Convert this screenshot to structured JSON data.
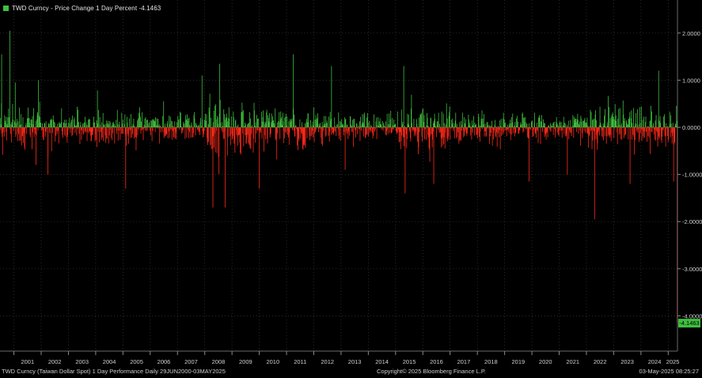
{
  "legend": {
    "label": "TWD Curncy - Price Change 1 Day Percent -4.1463",
    "color": "#3fbf3f"
  },
  "footer": {
    "left": "TWD Curncy (Taiwan Dollar Spot) 1 Day Performance  Daily 29JUN2000-03MAY2025",
    "center": "Copyright© 2025 Bloomberg Finance L.P.",
    "right": "03-May-2025 08:25:27"
  },
  "colors": {
    "background": "#000000",
    "positive": "#3fbf3f",
    "negative": "#ff2a1a",
    "grid": "#3a3a3a",
    "last_value_badge": "#3fbf3f"
  },
  "chart_data": {
    "type": "bar",
    "title": "TWD Curncy - Price Change 1 Day Percent",
    "last_value": -4.1463,
    "last_value_label": "-4.1463",
    "x_range": [
      2000.49,
      2025.34
    ],
    "ylim": [
      -4.6,
      2.6
    ],
    "y_ticks": [
      2.0,
      1.0,
      0.0,
      -1.0,
      -2.0,
      -3.0,
      -4.0
    ],
    "y_tick_labels": [
      "2.0000",
      "1.0000",
      "0.0000",
      "-1.0000",
      "-2.0000",
      "-3.0000",
      "-4.0000"
    ],
    "x_tick_labels": [
      "2001",
      "2002",
      "2003",
      "2004",
      "2005",
      "2006",
      "2007",
      "2008",
      "2009",
      "2010",
      "2011",
      "2012",
      "2013",
      "2014",
      "2015",
      "2016",
      "2017",
      "2018",
      "2019",
      "2020",
      "2021",
      "2022",
      "2023",
      "2024",
      "2025"
    ],
    "grid": true,
    "y_axis_position": "right",
    "notable_points": [
      {
        "x": 2000.55,
        "y": 1.55
      },
      {
        "x": 2000.85,
        "y": 2.05
      },
      {
        "x": 2001.05,
        "y": 0.95
      },
      {
        "x": 2001.9,
        "y": 1.0
      },
      {
        "x": 2002.25,
        "y": -1.0
      },
      {
        "x": 2005.1,
        "y": -1.3
      },
      {
        "x": 2007.9,
        "y": 1.1
      },
      {
        "x": 2008.3,
        "y": -1.7
      },
      {
        "x": 2008.75,
        "y": -1.7
      },
      {
        "x": 2008.55,
        "y": 1.35
      },
      {
        "x": 2010.0,
        "y": -1.3
      },
      {
        "x": 2011.25,
        "y": 1.55
      },
      {
        "x": 2012.65,
        "y": 1.3
      },
      {
        "x": 2013.15,
        "y": -0.9
      },
      {
        "x": 2015.3,
        "y": 1.3
      },
      {
        "x": 2015.35,
        "y": -1.4
      },
      {
        "x": 2016.4,
        "y": -1.2
      },
      {
        "x": 2019.9,
        "y": -1.15
      },
      {
        "x": 2021.3,
        "y": -1.0
      },
      {
        "x": 2022.3,
        "y": -1.95
      },
      {
        "x": 2023.6,
        "y": -1.2
      },
      {
        "x": 2024.65,
        "y": 1.2
      },
      {
        "x": 2025.2,
        "y": -1.15
      },
      {
        "x": 2025.33,
        "y": -4.1463
      }
    ],
    "volatility_by_year": {
      "2000": 0.42,
      "2001": 0.4,
      "2002": 0.34,
      "2003": 0.3,
      "2004": 0.35,
      "2005": 0.33,
      "2006": 0.3,
      "2007": 0.26,
      "2008": 0.55,
      "2009": 0.5,
      "2010": 0.4,
      "2011": 0.42,
      "2012": 0.3,
      "2013": 0.28,
      "2014": 0.26,
      "2015": 0.42,
      "2016": 0.4,
      "2017": 0.3,
      "2018": 0.3,
      "2019": 0.27,
      "2020": 0.28,
      "2021": 0.27,
      "2022": 0.42,
      "2023": 0.4,
      "2024": 0.36,
      "2025": 0.4
    }
  }
}
